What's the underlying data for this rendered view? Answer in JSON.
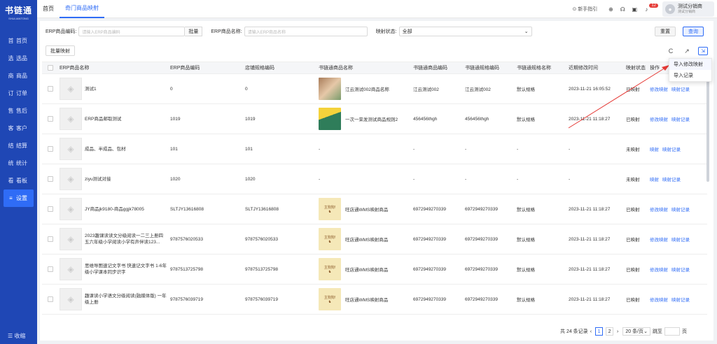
{
  "app": {
    "logo": "书链通",
    "logo_sub": "SHULIANTONG"
  },
  "sidebar": {
    "items": [
      {
        "icon": "首",
        "label": "首页"
      },
      {
        "icon": "选",
        "label": "选品"
      },
      {
        "icon": "商",
        "label": "商品"
      },
      {
        "icon": "订",
        "label": "订单"
      },
      {
        "icon": "售",
        "label": "售后"
      },
      {
        "icon": "客",
        "label": "客户"
      },
      {
        "icon": "结",
        "label": "结算"
      },
      {
        "icon": "统",
        "label": "统计"
      },
      {
        "icon": "看",
        "label": "看板"
      },
      {
        "icon": "≡",
        "label": "设置"
      }
    ],
    "collapse": "☰ 收缩"
  },
  "tabs": [
    {
      "label": "首页"
    },
    {
      "label": "奇门商品映射"
    }
  ],
  "header": {
    "guide": "⊙ 新手指引",
    "badge": "12",
    "user_name": "测试分销商",
    "user_sub": "测试分销商"
  },
  "filters": {
    "erp_code_label": "ERP商品编码:",
    "erp_code_placeholder": "请输入ERP商品编码",
    "batch_label": "批量",
    "erp_name_label": "ERP商品名称:",
    "erp_name_placeholder": "请输入ERP商品名称",
    "map_status_label": "映射状态:",
    "map_status_value": "全部",
    "reset": "重置",
    "query": "查询"
  },
  "toolbar": {
    "bulk_map": "批量映射"
  },
  "table": {
    "headers": [
      "ERP商品名称",
      "ERP商品编码",
      "店铺规格编码",
      "书链通商品名称",
      "书链通商品编码",
      "书链通规格编码",
      "书链通规格名称",
      "近期修改时间",
      "映射状态",
      "操作"
    ],
    "rows": [
      {
        "erp_name": "测试1",
        "erp_code": "0",
        "shop_code": "0",
        "sname": "江云测试002商品名称",
        "img": "baby",
        "scode": "江云测试002",
        "scode2": "江云测试002",
        "spec": "默认规格",
        "time": "2023-11-21 16:05:52",
        "status": "已映射",
        "ops": [
          "修改映射",
          "映射记录"
        ]
      },
      {
        "erp_name": "ERP商品邮取测试",
        "erp_code": "1019",
        "shop_code": "1019",
        "sname": "一次一荣发测试商品规则2",
        "img": "doc",
        "scode": "456456thgh",
        "scode2": "456456thgh",
        "spec": "默认规格",
        "time": "2023-11-21 11:18:27",
        "status": "已映射",
        "ops": [
          "修改映射",
          "映射记录"
        ]
      },
      {
        "erp_name": "成品、半成品、包材",
        "erp_code": "101",
        "shop_code": "101",
        "sname": "-",
        "img": "",
        "scode": "-",
        "scode2": "-",
        "spec": "-",
        "time": "-",
        "status": "未映射",
        "ops": [
          "映射",
          "映射记录"
        ]
      },
      {
        "erp_name": "ziyu测试对接",
        "erp_code": "1020",
        "shop_code": "1020",
        "sname": "-",
        "img": "",
        "scode": "-",
        "scode2": "-",
        "spec": "-",
        "time": "-",
        "status": "未映射",
        "ops": [
          "映射",
          "映射记录"
        ]
      },
      {
        "erp_name": "JY商品jk9180-商品ggjk78005",
        "erp_code": "SLTJY13616808",
        "shop_code": "SLTJY13616808",
        "sname": "旺店通WMS映射商品",
        "img": "pig",
        "scode": "6972949270339",
        "scode2": "6972949270339",
        "spec": "默认规格",
        "time": "2023-11-21 11:18:27",
        "status": "已映射",
        "ops": [
          "修改映射",
          "映射记录"
        ]
      },
      {
        "erp_name": "2023趣课读读文分级阅读一二三上册四五六年级小学阅读小学有声伴读123...",
        "erp_code": "9787576020533",
        "shop_code": "9787576020533",
        "sname": "旺店通WMS映射商品",
        "img": "pig",
        "scode": "6972949270339",
        "scode2": "6972949270339",
        "spec": "默认规格",
        "time": "2023-11-21 11:18:27",
        "status": "已映射",
        "ops": [
          "修改映射",
          "映射记录"
        ]
      },
      {
        "erp_name": "思维导图速记文字书 快速记文字书 1-6年级小学课本同步识字",
        "erp_code": "9787513725798",
        "shop_code": "9787513725798",
        "sname": "旺店通WMS映射商品",
        "img": "pig",
        "scode": "6972949270339",
        "scode2": "6972949270339",
        "spec": "默认规格",
        "time": "2023-11-21 11:18:27",
        "status": "已映射",
        "ops": [
          "修改映射",
          "映射记录"
        ]
      },
      {
        "erp_name": "趣课读小学语文分级阅读(融媒体版) 一年级上册",
        "erp_code": "9787576039719",
        "shop_code": "9787576039719",
        "sname": "旺店通WMS映射商品",
        "img": "pig",
        "scode": "6972949270339",
        "scode2": "6972949270339",
        "spec": "默认规格",
        "time": "2023-11-21 11:18:27",
        "status": "已映射",
        "ops": [
          "修改映射",
          "映射记录"
        ]
      }
    ],
    "pig_text": "主狗狗!"
  },
  "tools": {
    "refresh": "C",
    "export": "↗",
    "import": "⇲"
  },
  "dropdown": {
    "items": [
      "导入修改映射",
      "导入记录"
    ]
  },
  "pagination": {
    "total": "共 24 条记录",
    "pages": [
      "1",
      "2"
    ],
    "size": "20 条/页",
    "jump_label": "跳至",
    "page_unit": "页"
  },
  "colors": {
    "sidebar": "#1f47b5",
    "accent": "#2f6cf6",
    "annotation": "#e53935"
  }
}
